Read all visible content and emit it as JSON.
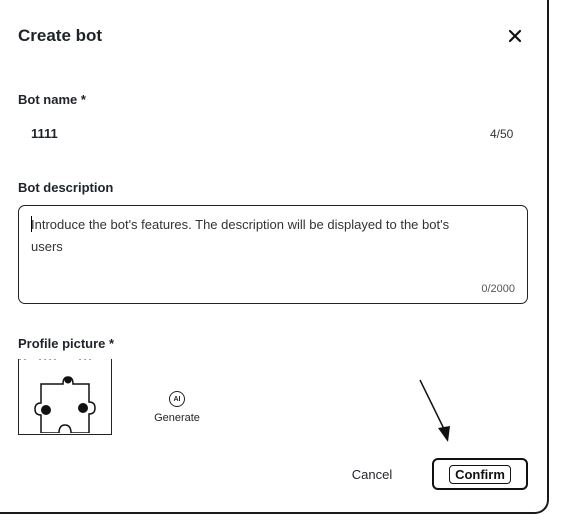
{
  "dialog": {
    "title": "Create bot",
    "close_icon": "close-icon"
  },
  "bot_name": {
    "label": "Bot name *",
    "value": "1111",
    "counter": "4/50"
  },
  "bot_description": {
    "label": "Bot description",
    "placeholder": "Introduce the bot's features. The description will be displayed to the bot's users",
    "counter": "0/2000"
  },
  "profile_picture": {
    "label": "Profile picture *",
    "avatar_icon": "puzzle-avatar-icon",
    "generate_icon": "ai-icon",
    "generate_icon_text": "AI",
    "generate_label": "Generate"
  },
  "footer": {
    "cancel_label": "Cancel",
    "confirm_label": "Confirm"
  }
}
